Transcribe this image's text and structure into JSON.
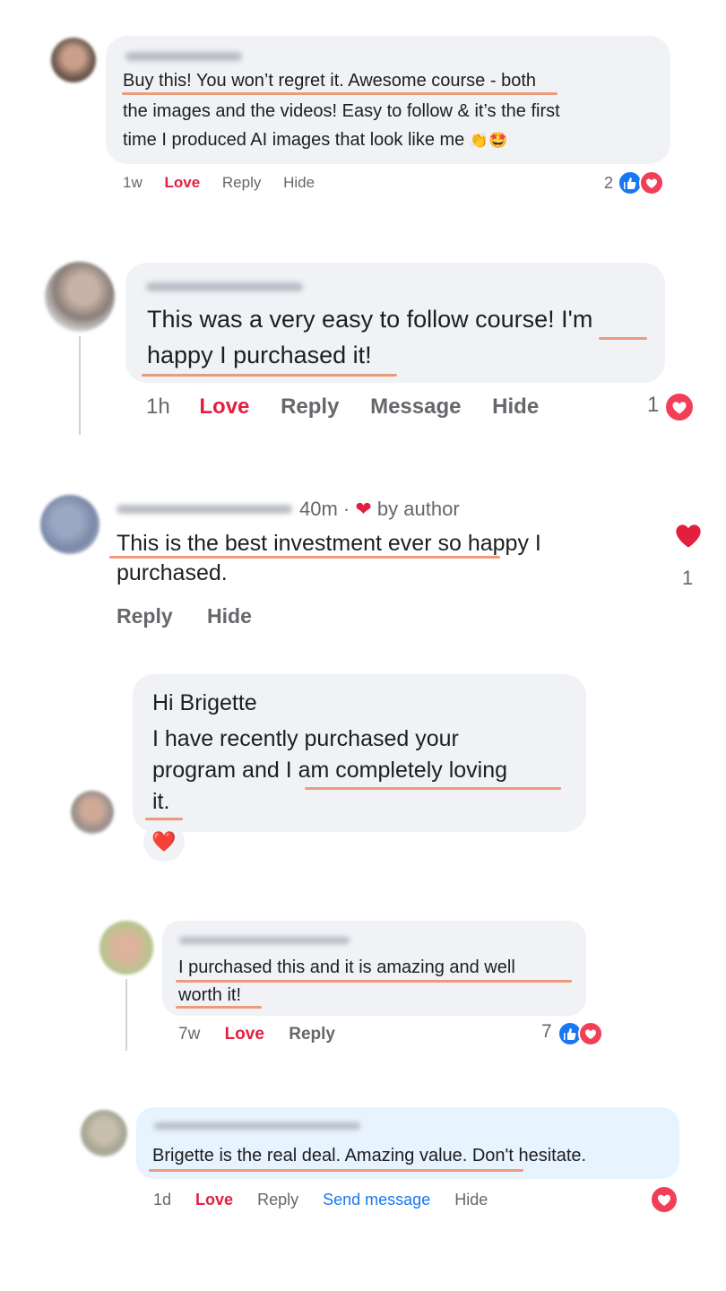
{
  "comment1": {
    "lines": [
      "Buy this! You won’t regret it. Awesome course - both",
      "the images and the videos! Easy to follow & it’s the first",
      "time I produced AI images that look like me"
    ],
    "emoji": "👏🤩",
    "time": "1w",
    "love": "Love",
    "reply": "Reply",
    "hide": "Hide",
    "count": "2"
  },
  "comment2": {
    "lines": [
      "This was a very easy to follow course! I'm",
      "happy I purchased it!"
    ],
    "time": "1h",
    "love": "Love",
    "reply": "Reply",
    "message": "Message",
    "hide": "Hide",
    "count": "1"
  },
  "comment3": {
    "time_author": "40m · ",
    "by_author": "by author",
    "lines": [
      "This is the best investment ever so happy I",
      "purchased."
    ],
    "reply": "Reply",
    "hide": "Hide",
    "like_count": "1"
  },
  "comment4": {
    "lines": [
      "Hi Brigette",
      "I have recently purchased your",
      "program and I am completely loving",
      "it."
    ],
    "reaction": "❤️"
  },
  "comment5": {
    "lines": [
      "I purchased this and it is amazing and well",
      "worth it!"
    ],
    "time": "7w",
    "love": "Love",
    "reply": "Reply",
    "count": "7"
  },
  "comment6": {
    "lines": [
      "Brigette is the real deal. Amazing value. Don't hesitate."
    ],
    "time": "1d",
    "love": "Love",
    "reply": "Reply",
    "send_message": "Send message",
    "hide": "Hide"
  },
  "colors": {
    "bubble": "#f0f2f5",
    "underline": "#ec9a7c",
    "love": "#e41e3f",
    "like": "#1877f2",
    "heart": "#f33e58"
  }
}
